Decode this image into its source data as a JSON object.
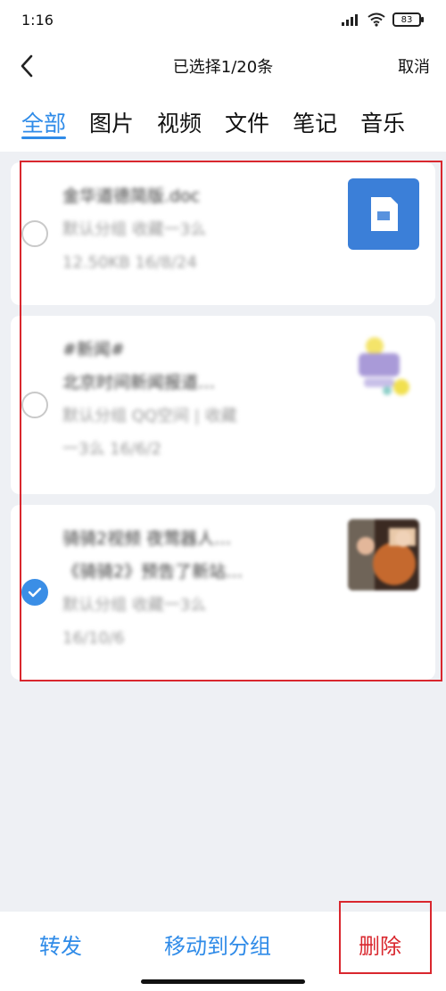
{
  "status": {
    "time": "1:16",
    "battery": "83"
  },
  "header": {
    "title": "已选择1/20条",
    "cancel_label": "取消"
  },
  "tabs": [
    {
      "label": "全部",
      "active": true
    },
    {
      "label": "图片",
      "active": false
    },
    {
      "label": "视频",
      "active": false
    },
    {
      "label": "文件",
      "active": false
    },
    {
      "label": "笔记",
      "active": false
    },
    {
      "label": "音乐",
      "active": false
    }
  ],
  "items": [
    {
      "title": "金华道德简版.doc",
      "meta1": "默认分组 收藏一3么",
      "meta2": "12.50KB 16/8/24",
      "selected": false,
      "thumb": "doc-icon"
    },
    {
      "title": "#新闻#",
      "title2": "北京时间新闻报道…",
      "meta1": "默认分组 QQ空间 | 收藏",
      "meta2": "一3么 16/6/2",
      "selected": false,
      "thumb": "news-image"
    },
    {
      "title": "骑骑2视频 夜莺器人…",
      "title2": "《骑骑2》预告了新站…",
      "meta1": "默认分组 收藏一3么",
      "meta2": "16/10/6",
      "selected": true,
      "thumb": "photo-image"
    }
  ],
  "bottom": {
    "forward_label": "转发",
    "move_label": "移动到分组",
    "delete_label": "删除"
  },
  "colors": {
    "accent": "#2f8be8",
    "danger": "#d9272e",
    "background": "#eef0f4"
  }
}
